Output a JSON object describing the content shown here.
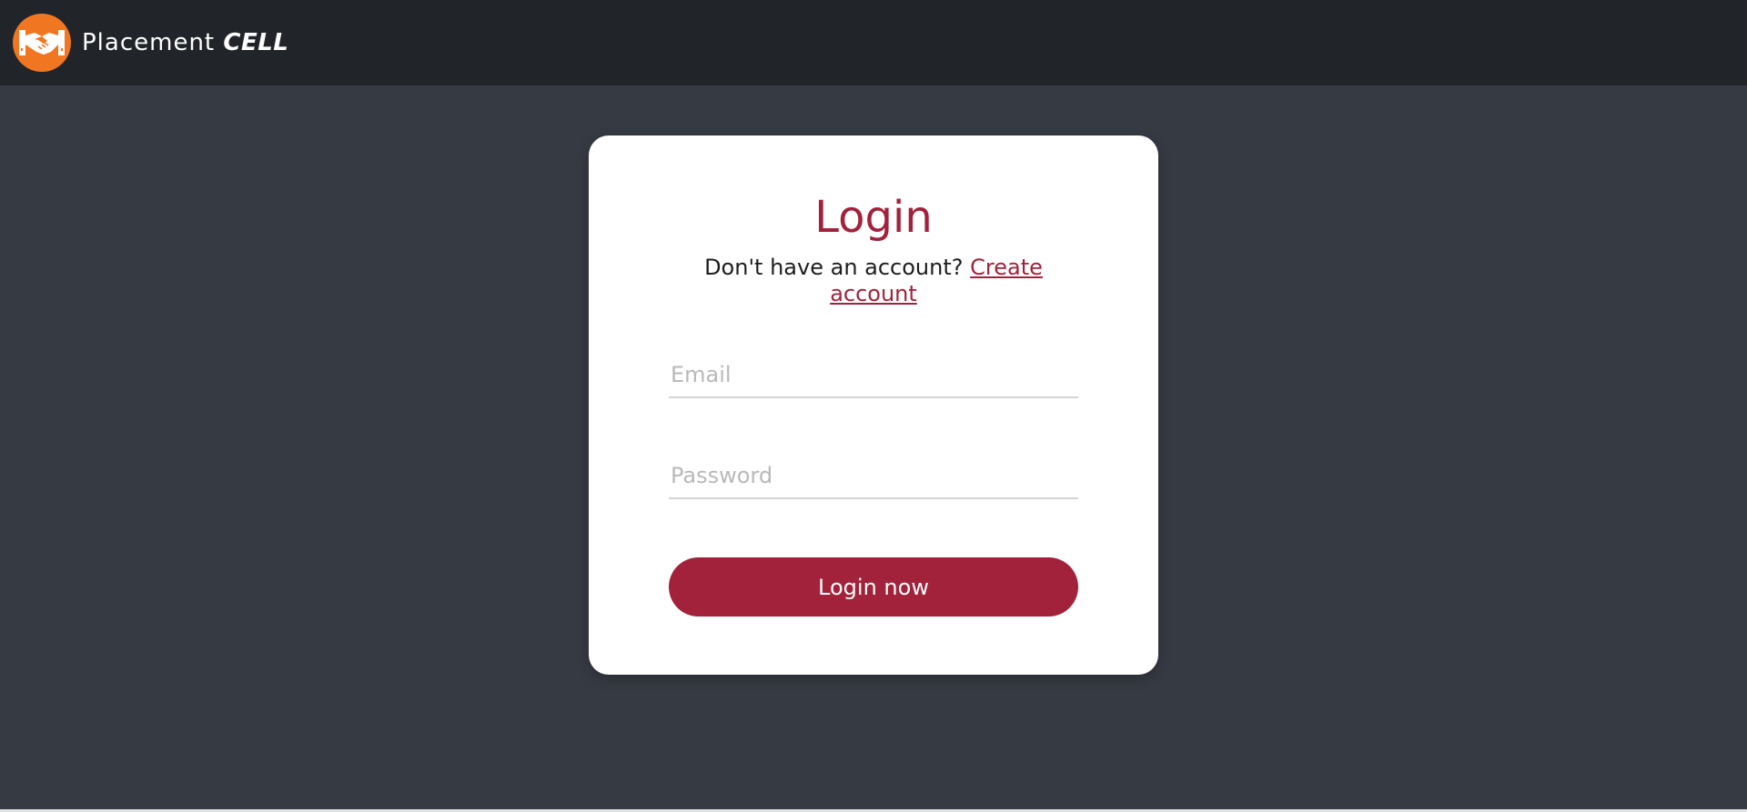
{
  "navbar": {
    "brand_name": "Placement",
    "brand_name_bold": "CELL",
    "logo_icon": "handshake-icon",
    "logo_color": "#f07622",
    "background": "#212429"
  },
  "login": {
    "title": "Login",
    "prompt": "Don't have an account?",
    "signup_link": "Create account",
    "email_placeholder": "Email",
    "password_placeholder": "Password",
    "submit_label": "Login now",
    "accent_color": "#a2223b"
  },
  "page": {
    "background": "#363a43"
  }
}
